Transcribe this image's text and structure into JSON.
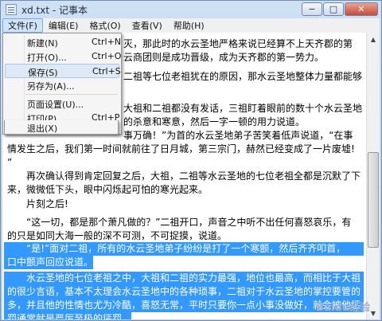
{
  "window": {
    "title": "xd.txt - 记事本",
    "min": "−",
    "max": "□",
    "close": "✕"
  },
  "menubar": {
    "file": "文件(F)",
    "edit": "编辑(E)",
    "format": "格式(O)",
    "view": "查看(V)",
    "help": "帮助(H)"
  },
  "file_menu": {
    "new": {
      "label": "新建(N)",
      "key": "Ctrl+N"
    },
    "open": {
      "label": "打开(O)...",
      "key": "Ctrl+O"
    },
    "save": {
      "label": "保存(S)",
      "key": "Ctrl+S"
    },
    "save_as": {
      "label": "另存为(A)..."
    },
    "page_setup": {
      "label": "页面设置(U)..."
    },
    "print": {
      "label": "打印(P)...",
      "key": "Ctrl+P"
    },
    "exit": {
      "label": "退出(X)"
    }
  },
  "lines": [
    "灭，那此时的水云圣地严格来说已经算不上天齐郡的第",
    "云商团则是成功晋级，成为天齐郡的第一势力。",
    "二祖等七位老祖犹在的原因，那水云圣地整体力量都能够",
    "大祖和二祖都没有发话，三祖盯着眼前的数十个水云圣地",
    "的杀意和寒意，然后一字一顿的用力说道。",
    "事万确！”为首的水云圣地弟子苦笑着低声说道，“在事",
    "情发生之后，我们第一时间就前往了日月城，第三宗门，赫然已经变成了一片废墟!",
    "”",
    "再次确认得到肯定回复之后，大祖，二祖等水云圣地的七位老祖全都是沉默了下",
    "来，微微低下头，眼中闪烁起可怕的寒光起来。",
    "片刻之后!",
    "“这一切，都是那个萧凡做的？”二祖开口，声音之中听不出任何喜怒哀乐，有",
    "的只是如同大海一般的深不可测，不可捉摸，说道。",
    "“是!”面对二祖，所有的水云圣地弟子纷纷是打了一个寒颤，然后齐齐叩首，",
    "口中颤声回应说道。",
    "水云圣地的七位老祖之中，大祖和二祖的实力最强，地位也最高，而相比于大祖",
    "的很少言语，基本不太理会水云圣地中的各种琐事，二祖对于水云圣地的掌控要管的",
    "多，并且他的性情也尤为冷酷，喜怒无常，平时只要你一点小事没做好，就会被他惩",
    "罚通常就是严厉至极的惩罚。"
  ],
  "watermark": "Baidu经验"
}
